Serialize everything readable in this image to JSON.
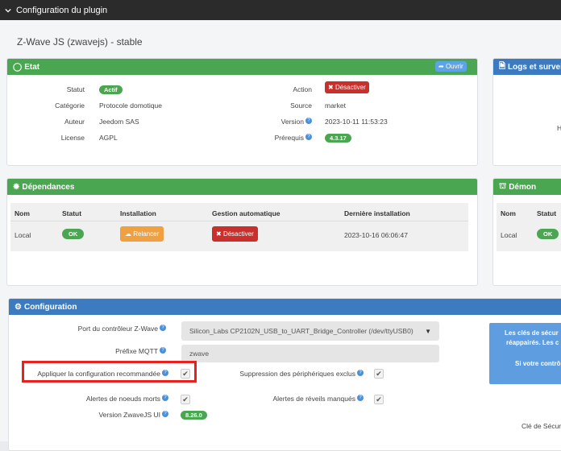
{
  "window": {
    "title": "Configuration du plugin"
  },
  "plugin_title": "Z-Wave JS (zwavejs) - stable",
  "etat": {
    "title": "Etat",
    "open_button": "Ouvrir",
    "statut_label": "Statut",
    "statut_value": "Actif",
    "categorie_label": "Catégorie",
    "categorie_value": "Protocole domotique",
    "auteur_label": "Auteur",
    "auteur_value": "Jeedom SAS",
    "licence_label": "License",
    "licence_value": "AGPL",
    "action_label": "Action",
    "action_button": "Désactiver",
    "source_label": "Source",
    "source_value": "market",
    "version_label": "Version",
    "version_value": "2023-10-11 11:53:23",
    "prerequis_label": "Prérequis",
    "prerequis_value": "4.3.17"
  },
  "logs": {
    "title": "Logs et surveil",
    "partial_char": "H"
  },
  "dependances": {
    "title": "Dépendances",
    "headers": [
      "Nom",
      "Statut",
      "Installation",
      "Gestion automatique",
      "Dernière installation"
    ],
    "row": {
      "nom": "Local",
      "statut": "OK",
      "installation": "Relancer",
      "gestion": "Désactiver",
      "derniere": "2023-10-16 06:06:47"
    }
  },
  "demon": {
    "title": "Démon",
    "headers": [
      "Nom",
      "Statut"
    ],
    "row": {
      "nom": "Local",
      "statut": "OK"
    }
  },
  "configuration": {
    "title": "Configuration",
    "port_label": "Port du contrôleur Z-Wave",
    "port_value": "Silicon_Labs CP2102N_USB_to_UART_Bridge_Controller (/dev/ttyUSB0)",
    "prefixe_label": "Préfixe MQTT",
    "prefixe_value": "zwave",
    "appliquer_label": "Appliquer la configuration recommandée",
    "suppression_label": "Suppression des périphériques exclus",
    "alertes_morts_label": "Alertes de noeuds morts",
    "alertes_reveils_label": "Alertes de réveils manqués",
    "version_ui_label": "Version ZwaveJS UI",
    "version_ui_value": "8.26.0",
    "info_line1": "Les clés de sécur",
    "info_line2": "réappairés. Les c",
    "info_line3": "Si votre contrô",
    "cle_label": "Clé de Sécur"
  },
  "colors": {
    "green": "#4aa651",
    "blue": "#3c7bbf",
    "red": "#c9302c",
    "orange": "#f0a040",
    "highlight": "#e8211c"
  }
}
